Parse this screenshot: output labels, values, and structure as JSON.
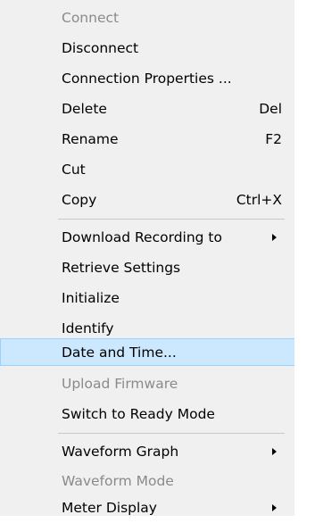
{
  "menu": {
    "items": [
      {
        "label": "Connect",
        "disabled": true
      },
      {
        "label": "Disconnect"
      },
      {
        "label": "Connection Properties ..."
      },
      {
        "label": "Delete",
        "shortcut": "Del"
      },
      {
        "label": "Rename",
        "shortcut": "F2"
      },
      {
        "label": "Cut"
      },
      {
        "label": "Copy",
        "shortcut": "Ctrl+X"
      },
      {
        "label": "Download Recording to",
        "submenu": true
      },
      {
        "label": "Retrieve Settings"
      },
      {
        "label": "Initialize"
      },
      {
        "label": "Identify"
      },
      {
        "label": "Date and Time...",
        "highlighted": true
      },
      {
        "label": "Upload Firmware",
        "disabled": true
      },
      {
        "label": "Switch to Ready Mode"
      },
      {
        "label": "Waveform Graph",
        "submenu": true
      },
      {
        "label": "Waveform Mode",
        "disabled": true
      },
      {
        "label": "Meter Display",
        "submenu": true
      }
    ]
  },
  "colors": {
    "menu_background": "#f0f0f0",
    "highlight_background": "#cce8ff",
    "highlight_border": "#99d1ff",
    "disabled_text": "#8a8a8a"
  }
}
